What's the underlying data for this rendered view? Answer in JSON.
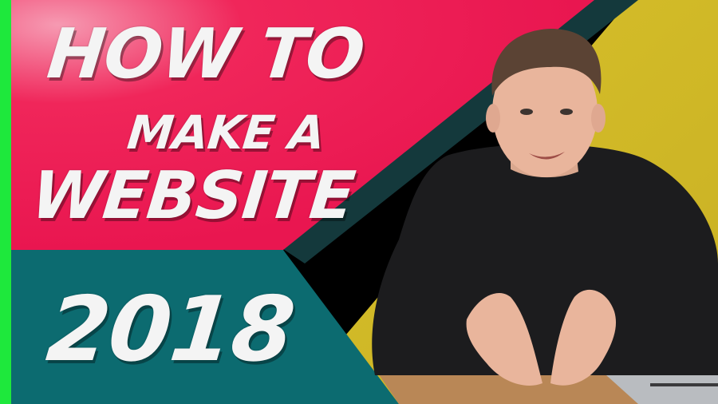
{
  "title_lines": [
    "HOW TO",
    "MAKE A",
    "WEBSITE"
  ],
  "year": "2018",
  "colors": {
    "red": "#f0265a",
    "teal": "#0c6b70",
    "dark_teal": "#14393c",
    "yellow": "#d4c12a",
    "green_edge": "#1ee83c",
    "sweater": "#1c1c1e",
    "skin": "#e9b59c",
    "desk": "#b98756"
  }
}
